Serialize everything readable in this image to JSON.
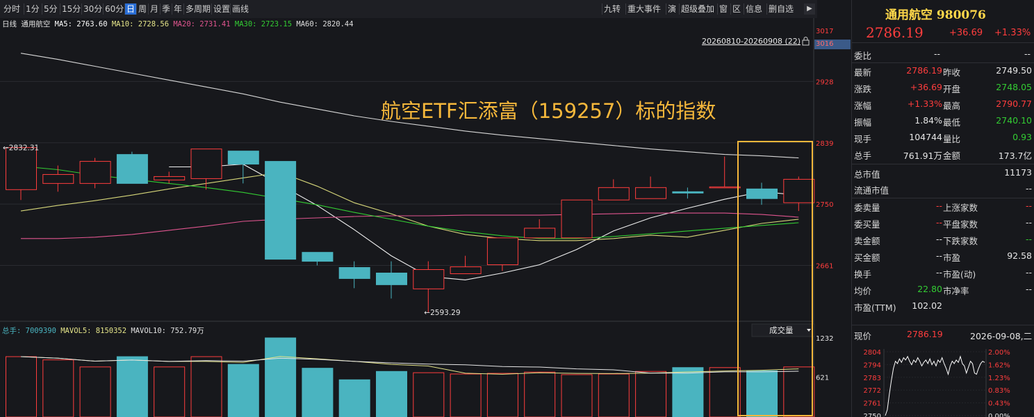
{
  "toolbar": {
    "periods": [
      "分时",
      "1分",
      "5分",
      "15分",
      "30分",
      "60分",
      "日",
      "周",
      "月",
      "季",
      "年",
      "多周期",
      "设置",
      "画线"
    ],
    "active_period": "日",
    "right_tools": [
      "九转",
      "重大事件",
      "演",
      "超级叠加",
      "窗",
      "区",
      "信息",
      "删自选"
    ],
    "collapse_icon": "collapse-right-icon"
  },
  "ma_legend": {
    "period": "日线",
    "name": "通用航空",
    "items": [
      {
        "label": "MA5: 2763.60",
        "color": "#ffffff"
      },
      {
        "label": "MA10: 2728.56",
        "color": "#e5e58a"
      },
      {
        "label": "MA20: 2731.41",
        "color": "#e0558f"
      },
      {
        "label": "MA30: 2723.15",
        "color": "#33cc33"
      },
      {
        "label": "MA60: 2820.44",
        "color": "#dddddd"
      }
    ]
  },
  "range_label": "20260810-20260908 (22)",
  "lock_icon": "lock-icon",
  "annotation": "航空ETF汇添富（159257）标的指数",
  "chart_data": {
    "type": "candlestick",
    "price_ticks": [
      3017,
      3016,
      2928,
      2839,
      2750,
      2661
    ],
    "ylim": [
      2580,
      3020
    ],
    "candles": [
      {
        "o": 2771,
        "c": 2832,
        "h": 2832,
        "l": 2756
      },
      {
        "o": 2780,
        "c": 2793,
        "h": 2806,
        "l": 2768
      },
      {
        "o": 2780,
        "c": 2812,
        "h": 2817,
        "l": 2773
      },
      {
        "o": 2822,
        "c": 2780,
        "h": 2826,
        "l": 2780
      },
      {
        "o": 2785,
        "c": 2790,
        "h": 2797,
        "l": 2780
      },
      {
        "o": 2787,
        "c": 2830,
        "h": 2830,
        "l": 2771
      },
      {
        "o": 2827,
        "c": 2808,
        "h": 2827,
        "l": 2780
      },
      {
        "o": 2812,
        "c": 2670,
        "h": 2812,
        "l": 2670
      },
      {
        "o": 2680,
        "c": 2667,
        "h": 2680,
        "l": 2661
      },
      {
        "o": 2658,
        "c": 2642,
        "h": 2667,
        "l": 2628
      },
      {
        "o": 2650,
        "c": 2633,
        "h": 2667,
        "l": 2613
      },
      {
        "o": 2627,
        "c": 2655,
        "h": 2667,
        "l": 2593
      },
      {
        "o": 2649,
        "c": 2659,
        "h": 2675,
        "l": 2649
      },
      {
        "o": 2662,
        "c": 2701,
        "h": 2701,
        "l": 2653
      },
      {
        "o": 2701,
        "c": 2715,
        "h": 2728,
        "l": 2701
      },
      {
        "o": 2701,
        "c": 2756,
        "h": 2756,
        "l": 2701
      },
      {
        "o": 2756,
        "c": 2774,
        "h": 2786,
        "l": 2756
      },
      {
        "o": 2758,
        "c": 2774,
        "h": 2790,
        "l": 2758
      },
      {
        "o": 2768,
        "c": 2766,
        "h": 2774,
        "l": 2758
      },
      {
        "o": 2774,
        "c": 2775,
        "h": 2819,
        "l": 2774
      },
      {
        "o": 2772,
        "c": 2758,
        "h": 2781,
        "l": 2749
      },
      {
        "o": 2752,
        "c": 2786,
        "h": 2790,
        "l": 2740
      }
    ],
    "low_label": "2593.29",
    "high_label": "2832.31",
    "ma_lines": [
      {
        "name": "MA5",
        "color": "#f0f0f0",
        "values": [
          null,
          null,
          null,
          null,
          2804,
          2804,
          2808,
          2778,
          2748,
          2713,
          2675,
          2645,
          2640,
          2650,
          2662,
          2684,
          2711,
          2730,
          2744,
          2757,
          2768,
          2763
        ]
      },
      {
        "name": "MA10",
        "color": "#d7d77a",
        "values": [
          2740,
          2748,
          2755,
          2763,
          2772,
          2780,
          2788,
          2796,
          2776,
          2752,
          2736,
          2718,
          2706,
          2700,
          2697,
          2697,
          2700,
          2705,
          2702,
          2712,
          2722,
          2728
        ]
      },
      {
        "name": "MA20",
        "color": "#e0558f",
        "values": [
          2700,
          2700,
          2702,
          2706,
          2712,
          2718,
          2725,
          2728,
          2730,
          2732,
          2733,
          2733,
          2734,
          2734,
          2734,
          2735,
          2736,
          2737,
          2737,
          2737,
          2735,
          2731
        ]
      },
      {
        "name": "MA30",
        "color": "#33cc33",
        "values": [
          2805,
          2800,
          2792,
          2786,
          2780,
          2774,
          2767,
          2758,
          2749,
          2738,
          2728,
          2718,
          2710,
          2704,
          2700,
          2700,
          2703,
          2707,
          2711,
          2715,
          2719,
          2723
        ]
      },
      {
        "name": "MA60",
        "color": "#d8d8d8",
        "values": [
          2969,
          2960,
          2950,
          2940,
          2930,
          2920,
          2910,
          2898,
          2888,
          2878,
          2870,
          2863,
          2856,
          2850,
          2845,
          2840,
          2835,
          2830,
          2826,
          2822,
          2820,
          2817
        ]
      }
    ],
    "volume_legend": {
      "total": "总手: 7009390",
      "mavol5": "MAVOL5: 8150352",
      "mavol10": "MAVOL10: 752.79万"
    },
    "volume_dropdown": "成交量",
    "volume_ticks": [
      1232,
      621
    ],
    "volume_ylim": [
      0,
      1232
    ],
    "volumes": [
      940,
      890,
      780,
      940,
      780,
      940,
      820,
      1232,
      760,
      580,
      710,
      690,
      670,
      680,
      700,
      660,
      670,
      710,
      770,
      770,
      720,
      780
    ]
  },
  "quote": {
    "title": "通用航空 980076",
    "price": "2786.19",
    "change": "+36.69",
    "pct": "+1.33%",
    "wei_bi": {
      "label": "委比",
      "v1": "--",
      "v2": "--"
    },
    "rows": [
      {
        "l1": "最新",
        "v1": "2786.19",
        "c1": "red",
        "l2": "昨收",
        "v2": "2749.50",
        "c2": "white"
      },
      {
        "l1": "涨跌",
        "v1": "+36.69",
        "c1": "red",
        "l2": "开盘",
        "v2": "2748.05",
        "c2": "green"
      },
      {
        "l1": "涨幅",
        "v1": "+1.33%",
        "c1": "red",
        "l2": "最高",
        "v2": "2790.77",
        "c2": "red"
      },
      {
        "l1": "振幅",
        "v1": "1.84%",
        "c1": "white",
        "l2": "最低",
        "v2": "2740.10",
        "c2": "green"
      },
      {
        "l1": "现手",
        "v1": "104744",
        "c1": "white",
        "l2": "量比",
        "v2": "0.93",
        "c2": "green"
      },
      {
        "l1": "总手",
        "v1": "761.91万",
        "c1": "white",
        "l2": "金额",
        "v2": "173.7亿",
        "c2": "white"
      }
    ],
    "cap_rows": [
      {
        "label": "总市值",
        "value": "11173"
      },
      {
        "label": "流通市值",
        "value": "--"
      }
    ],
    "stat_rows": [
      {
        "l1": "委卖量",
        "v1": "--",
        "c1": "red",
        "l2": "上涨家数",
        "v2": "--",
        "c2": "red"
      },
      {
        "l1": "委买量",
        "v1": "--",
        "c1": "red",
        "l2": "平盘家数",
        "v2": "--",
        "c2": "white"
      },
      {
        "l1": "卖金额",
        "v1": "--",
        "c1": "white",
        "l2": "下跌家数",
        "v2": "--",
        "c2": "green"
      },
      {
        "l1": "买金额",
        "v1": "--",
        "c1": "white",
        "l2": "市盈",
        "v2": "92.58",
        "c2": "white"
      },
      {
        "l1": "换手",
        "v1": "--",
        "c1": "white",
        "l2": "市盈(动)",
        "v2": "--",
        "c2": "white"
      },
      {
        "l1": "均价",
        "v1": "22.80",
        "c1": "green",
        "l2": "市净率",
        "v2": "--",
        "c2": "white"
      },
      {
        "l1": "市盈(TTM)",
        "v1": "102.02",
        "c1": "white",
        "l2": "",
        "v2": "",
        "c2": "white"
      }
    ],
    "bottom": {
      "label": "现价",
      "price": "2786.19",
      "date": "2026-09-08,二"
    },
    "mini_chart": {
      "left_ticks": [
        "2804",
        "2794",
        "2783",
        "2772",
        "2761",
        "2750"
      ],
      "right_ticks": [
        "2.00%",
        "1.62%",
        "1.23%",
        "0.83%",
        "0.43%",
        "0.00%"
      ],
      "ylim": [
        2750,
        2804
      ],
      "values": [
        2750,
        2755,
        2768,
        2780,
        2790,
        2796,
        2794,
        2798,
        2795,
        2799,
        2797,
        2800,
        2796,
        2793,
        2797,
        2795,
        2799,
        2796,
        2792,
        2795,
        2797,
        2794,
        2798,
        2793,
        2796,
        2792,
        2797,
        2795,
        2799,
        2794,
        2790,
        2785,
        2792,
        2796,
        2794,
        2797,
        2795,
        2800,
        2794,
        2792,
        2786,
        2791,
        2796,
        2794,
        2786,
        2785,
        2790,
        2794,
        2796,
        2795
      ]
    }
  }
}
